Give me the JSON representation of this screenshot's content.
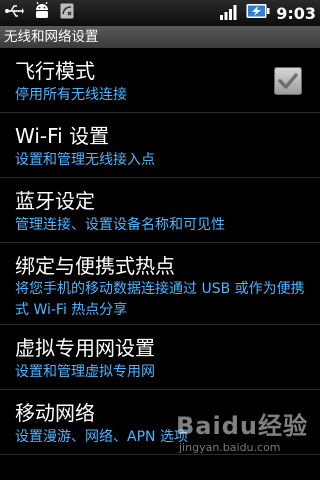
{
  "status_bar": {
    "time": "9:03",
    "icons": [
      "usb-icon",
      "android-debug-icon",
      "missed-call-icon",
      "signal-icon",
      "battery-charging-icon"
    ]
  },
  "screen": {
    "title": "无线和网络设置"
  },
  "settings": [
    {
      "title": "飞行模式",
      "summary": "停用所有无线连接",
      "checkbox": true,
      "checked": true
    },
    {
      "title": "Wi-Fi 设置",
      "summary": "设置和管理无线接入点"
    },
    {
      "title": "蓝牙设定",
      "summary": "管理连接、设置设备名称和可见性"
    },
    {
      "title": "绑定与便携式热点",
      "summary": "将您手机的移动数据连接通过 USB 或作为便携式 Wi-Fi 热点分享"
    },
    {
      "title": "虚拟专用网设置",
      "summary": "设置和管理虚拟专用网"
    },
    {
      "title": "移动网络",
      "summary": "设置漫游、网络、APN 选项"
    }
  ],
  "watermark": {
    "text": "Baidu经验",
    "url": "jingyan.baidu.com"
  },
  "colors": {
    "summary": "#4fb4ff",
    "background": "#000000",
    "title_bar": "#4a4a4a"
  }
}
